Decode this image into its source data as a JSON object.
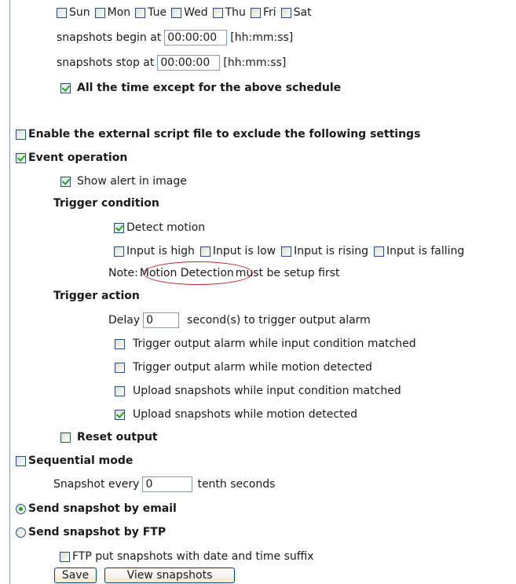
{
  "schedule": {
    "days": [
      {
        "label": "Sun",
        "checked": false
      },
      {
        "label": "Mon",
        "checked": false
      },
      {
        "label": "Tue",
        "checked": false
      },
      {
        "label": "Wed",
        "checked": false
      },
      {
        "label": "Thu",
        "checked": false
      },
      {
        "label": "Fri",
        "checked": false
      },
      {
        "label": "Sat",
        "checked": false
      }
    ],
    "begin_label": "snapshots begin at",
    "begin_value": "00:00:00",
    "begin_hint": "[hh:mm:ss]",
    "stop_label": "snapshots stop at",
    "stop_value": "00:00:00",
    "stop_hint": "[hh:mm:ss]",
    "all_time_label": "All the time except for the above schedule",
    "all_time_checked": true
  },
  "external_script": {
    "label": "Enable the external script file to exclude the following settings",
    "checked": false
  },
  "event_operation": {
    "label": "Event operation",
    "checked": true,
    "show_alert_label": "Show alert in image",
    "show_alert_checked": true,
    "trigger_condition_heading": "Trigger condition",
    "detect_motion_label": "Detect motion",
    "detect_motion_checked": true,
    "inputs": [
      {
        "label": "Input is high",
        "checked": false
      },
      {
        "label": "Input is low",
        "checked": false
      },
      {
        "label": "Input is rising",
        "checked": false
      },
      {
        "label": "Input is falling",
        "checked": false
      }
    ],
    "note_prefix": "Note:",
    "note_link": "Motion Detection",
    "note_suffix": "must be setup first",
    "trigger_action_heading": "Trigger action",
    "delay_label": "Delay",
    "delay_value": "0",
    "delay_suffix": "second(s) to trigger output alarm",
    "actions": [
      {
        "label": "Trigger output alarm while input condition matched",
        "checked": false
      },
      {
        "label": "Trigger output alarm while motion detected",
        "checked": false
      },
      {
        "label": "Upload snapshots while input condition matched",
        "checked": false
      },
      {
        "label": "Upload snapshots while motion detected",
        "checked": true
      }
    ],
    "reset_output_label": "Reset output",
    "reset_output_checked": false
  },
  "sequential": {
    "label": "Sequential mode",
    "checked": false,
    "every_label": "Snapshot every",
    "every_value": "0",
    "every_suffix": "tenth seconds"
  },
  "send": {
    "email_label": "Send snapshot by email",
    "email_selected": true,
    "ftp_label": "Send snapshot by FTP",
    "ftp_selected": false,
    "ftp_suffix_label": "FTP put snapshots with date and time suffix",
    "ftp_suffix_checked": false
  },
  "buttons": {
    "save": "Save",
    "view": "View snapshots"
  },
  "colors": {
    "check_mark": "#21a121",
    "border": "#1c5180",
    "annotation": "#c0262a"
  }
}
